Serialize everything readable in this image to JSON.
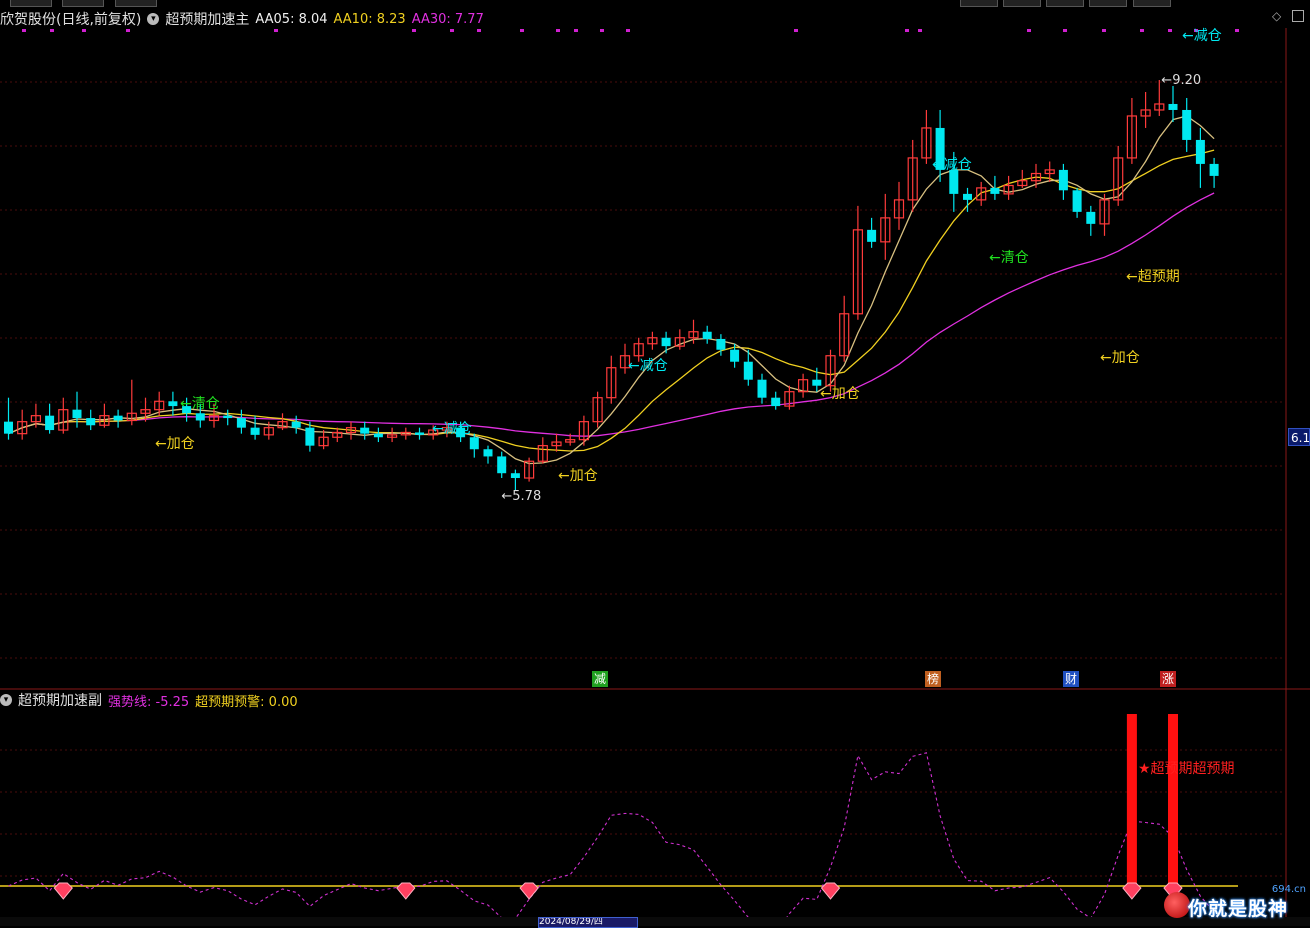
{
  "header": {
    "stock": "欣贺股份(日线,前复权)",
    "indicator": "超预期加速主",
    "ma5": "AA05: 8.04",
    "ma10": "AA10: 8.23",
    "ma30": "AA30: 7.77"
  },
  "sub_header": {
    "indicator": "超预期加速副",
    "line1": "强势线: -5.25",
    "line2": "超预期预警: 0.00"
  },
  "colors": {
    "up": "#ff3b3b",
    "down": "#00e8f0",
    "ma5": "#ffffff",
    "ma10": "#f0d020",
    "ma30": "#e030e0",
    "signal_yellow": "#f0d020",
    "signal_green": "#20e020",
    "signal_cyan": "#00e8f0"
  },
  "edge_label": "6.1",
  "date_label": "2024/08/29/四",
  "event_tags": [
    {
      "label": "减",
      "color": "#20a020"
    },
    {
      "label": "榜",
      "color": "#c06020"
    },
    {
      "label": "财",
      "color": "#2050c0"
    },
    {
      "label": "涨",
      "color": "#c02020"
    }
  ],
  "price_labels": {
    "low": "5.78",
    "high": "9.20"
  },
  "annotations": [
    {
      "text": "←清仓",
      "color": "#20e020"
    },
    {
      "text": "←加仓",
      "color": "#f0d020"
    },
    {
      "text": "←减仓",
      "color": "#00e8f0"
    },
    {
      "text": "←加仓",
      "color": "#f0d020"
    },
    {
      "text": "←减仓",
      "color": "#00e8f0"
    },
    {
      "text": "←加仓",
      "color": "#f0d020"
    },
    {
      "text": "←减仓",
      "color": "#00e8f0"
    },
    {
      "text": "←清仓",
      "color": "#20e020"
    },
    {
      "text": "←超预期",
      "color": "#f0d020"
    },
    {
      "text": "←加仓",
      "color": "#f0d020"
    },
    {
      "text": "←减仓",
      "color": "#00e8f0"
    }
  ],
  "sub_annotation": "★超预期超预期",
  "watermark": {
    "text": "你就是股神",
    "domain": "694.cn"
  },
  "chart_data": {
    "type": "candlestick",
    "series": [
      {
        "name": "AA05"
      },
      {
        "name": "AA10"
      },
      {
        "name": "AA30"
      }
    ],
    "candles": [
      [
        6.35,
        6.25,
        6.55,
        6.2
      ],
      [
        6.25,
        6.35,
        6.45,
        6.2
      ],
      [
        6.35,
        6.4,
        6.5,
        6.3
      ],
      [
        6.4,
        6.28,
        6.5,
        6.25
      ],
      [
        6.28,
        6.45,
        6.55,
        6.25
      ],
      [
        6.45,
        6.38,
        6.6,
        6.3
      ],
      [
        6.38,
        6.32,
        6.45,
        6.28
      ],
      [
        6.32,
        6.4,
        6.5,
        6.3
      ],
      [
        6.4,
        6.36,
        6.45,
        6.3
      ],
      [
        6.36,
        6.42,
        6.7,
        6.32
      ],
      [
        6.42,
        6.45,
        6.55,
        6.35
      ],
      [
        6.45,
        6.52,
        6.6,
        6.4
      ],
      [
        6.52,
        6.48,
        6.6,
        6.4
      ],
      [
        6.48,
        6.42,
        6.55,
        6.35
      ],
      [
        6.42,
        6.36,
        6.5,
        6.3
      ],
      [
        6.36,
        6.4,
        6.5,
        6.3
      ],
      [
        6.4,
        6.38,
        6.45,
        6.32
      ],
      [
        6.38,
        6.3,
        6.45,
        6.25
      ],
      [
        6.3,
        6.24,
        6.4,
        6.2
      ],
      [
        6.24,
        6.3,
        6.35,
        6.2
      ],
      [
        6.3,
        6.35,
        6.42,
        6.28
      ],
      [
        6.35,
        6.3,
        6.4,
        6.25
      ],
      [
        6.3,
        6.15,
        6.35,
        6.1
      ],
      [
        6.15,
        6.22,
        6.28,
        6.12
      ],
      [
        6.22,
        6.26,
        6.3,
        6.18
      ],
      [
        6.26,
        6.3,
        6.35,
        6.2
      ],
      [
        6.3,
        6.25,
        6.35,
        6.2
      ],
      [
        6.25,
        6.22,
        6.3,
        6.18
      ],
      [
        6.22,
        6.24,
        6.3,
        6.18
      ],
      [
        6.24,
        6.26,
        6.3,
        6.2
      ],
      [
        6.26,
        6.24,
        6.3,
        6.2
      ],
      [
        6.24,
        6.28,
        6.32,
        6.2
      ],
      [
        6.28,
        6.3,
        6.35,
        6.22
      ],
      [
        6.3,
        6.22,
        6.35,
        6.18
      ],
      [
        6.22,
        6.12,
        6.25,
        6.05
      ],
      [
        6.12,
        6.06,
        6.15,
        6.0
      ],
      [
        6.06,
        5.92,
        6.1,
        5.88
      ],
      [
        5.92,
        5.88,
        5.95,
        5.78
      ],
      [
        5.88,
        6.02,
        6.05,
        5.85
      ],
      [
        6.02,
        6.15,
        6.22,
        6.0
      ],
      [
        6.15,
        6.18,
        6.25,
        6.1
      ],
      [
        6.18,
        6.2,
        6.25,
        6.15
      ],
      [
        6.2,
        6.35,
        6.4,
        6.15
      ],
      [
        6.35,
        6.55,
        6.6,
        6.3
      ],
      [
        6.55,
        6.8,
        6.9,
        6.5
      ],
      [
        6.8,
        6.9,
        7.0,
        6.75
      ],
      [
        6.9,
        7.0,
        7.05,
        6.85
      ],
      [
        7.0,
        7.05,
        7.1,
        6.95
      ],
      [
        7.05,
        6.98,
        7.1,
        6.92
      ],
      [
        6.98,
        7.05,
        7.12,
        6.95
      ],
      [
        7.05,
        7.1,
        7.2,
        7.0
      ],
      [
        7.1,
        7.04,
        7.15,
        7.0
      ],
      [
        7.04,
        6.95,
        7.08,
        6.9
      ],
      [
        6.95,
        6.85,
        7.0,
        6.8
      ],
      [
        6.85,
        6.7,
        6.95,
        6.65
      ],
      [
        6.7,
        6.55,
        6.75,
        6.5
      ],
      [
        6.55,
        6.48,
        6.6,
        6.45
      ],
      [
        6.48,
        6.6,
        6.65,
        6.45
      ],
      [
        6.6,
        6.7,
        6.75,
        6.55
      ],
      [
        6.7,
        6.65,
        6.8,
        6.6
      ],
      [
        6.65,
        6.9,
        6.95,
        6.6
      ],
      [
        6.9,
        7.25,
        7.4,
        6.85
      ],
      [
        7.25,
        7.95,
        8.15,
        7.2
      ],
      [
        7.95,
        7.85,
        8.05,
        7.8
      ],
      [
        7.85,
        8.05,
        8.25,
        7.7
      ],
      [
        8.05,
        8.2,
        8.35,
        7.95
      ],
      [
        8.2,
        8.55,
        8.7,
        8.1
      ],
      [
        8.55,
        8.8,
        8.95,
        8.5
      ],
      [
        8.8,
        8.45,
        8.95,
        8.35
      ],
      [
        8.45,
        8.25,
        8.6,
        8.1
      ],
      [
        8.25,
        8.2,
        8.3,
        8.1
      ],
      [
        8.2,
        8.3,
        8.35,
        8.15
      ],
      [
        8.3,
        8.25,
        8.4,
        8.2
      ],
      [
        8.25,
        8.32,
        8.4,
        8.2
      ],
      [
        8.32,
        8.36,
        8.45,
        8.3
      ],
      [
        8.36,
        8.42,
        8.5,
        8.3
      ],
      [
        8.42,
        8.45,
        8.52,
        8.35
      ],
      [
        8.45,
        8.28,
        8.5,
        8.2
      ],
      [
        8.28,
        8.1,
        8.3,
        8.05
      ],
      [
        8.1,
        8.0,
        8.15,
        7.9
      ],
      [
        8.0,
        8.2,
        8.25,
        7.9
      ],
      [
        8.2,
        8.55,
        8.65,
        8.15
      ],
      [
        8.55,
        8.9,
        9.05,
        8.5
      ],
      [
        8.9,
        8.95,
        9.1,
        8.8
      ],
      [
        8.95,
        9.0,
        9.2,
        8.9
      ],
      [
        9.0,
        8.95,
        9.15,
        8.85
      ],
      [
        8.95,
        8.7,
        9.05,
        8.6
      ],
      [
        8.7,
        8.5,
        8.8,
        8.3
      ],
      [
        8.5,
        8.4,
        8.55,
        8.3
      ]
    ]
  }
}
